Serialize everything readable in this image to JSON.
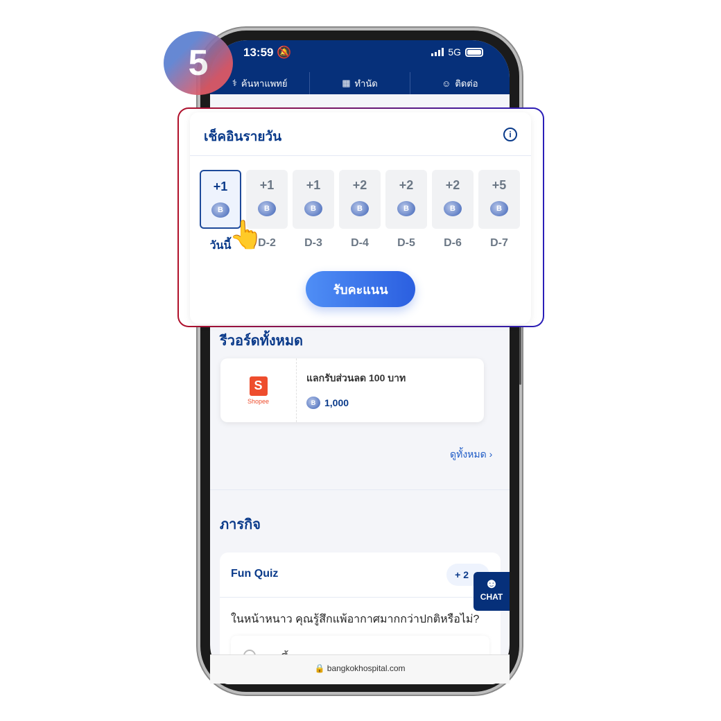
{
  "step_number": "5",
  "status": {
    "time": "13:59",
    "network": "5G"
  },
  "nav": [
    {
      "label": "ค้นหาแพทย์",
      "icon": "stethoscope-icon"
    },
    {
      "label": "ทำนัด",
      "icon": "calendar-icon"
    },
    {
      "label": "ติดต่อ",
      "icon": "chat-bubble-icon"
    }
  ],
  "checkin": {
    "title": "เช็คอินรายวัน",
    "claim_label": "รับคะแนน",
    "coin_letter": "B",
    "days": [
      {
        "points": "+1",
        "label": "วันนี้"
      },
      {
        "points": "+1",
        "label": "D-2"
      },
      {
        "points": "+1",
        "label": "D-3"
      },
      {
        "points": "+2",
        "label": "D-4"
      },
      {
        "points": "+2",
        "label": "D-5"
      },
      {
        "points": "+2",
        "label": "D-6"
      },
      {
        "points": "+5",
        "label": "D-7"
      }
    ]
  },
  "rewards": {
    "title": "รีวอร์ดทั้งหมด",
    "items": [
      {
        "brand": "Shopee",
        "name": "แลกรับส่วนลด 100 บาท",
        "cost": "1,000"
      }
    ],
    "see_all": "ดูทั้งหมด"
  },
  "missions": {
    "title": "ภารกิจ",
    "quiz": {
      "title": "Fun Quiz",
      "points": "+ 2",
      "question": "ในหน้าหนาว คุณรู้สึกแพ้อากาศมากกว่าปกติหรือไม่?",
      "option": "มากขึ้น"
    }
  },
  "chat_label": "CHAT",
  "url": "bangkokhospital.com",
  "colors": {
    "brand_navy": "#06307a",
    "accent_blue": "#2b5fe0",
    "shopee": "#ee4d2d"
  }
}
